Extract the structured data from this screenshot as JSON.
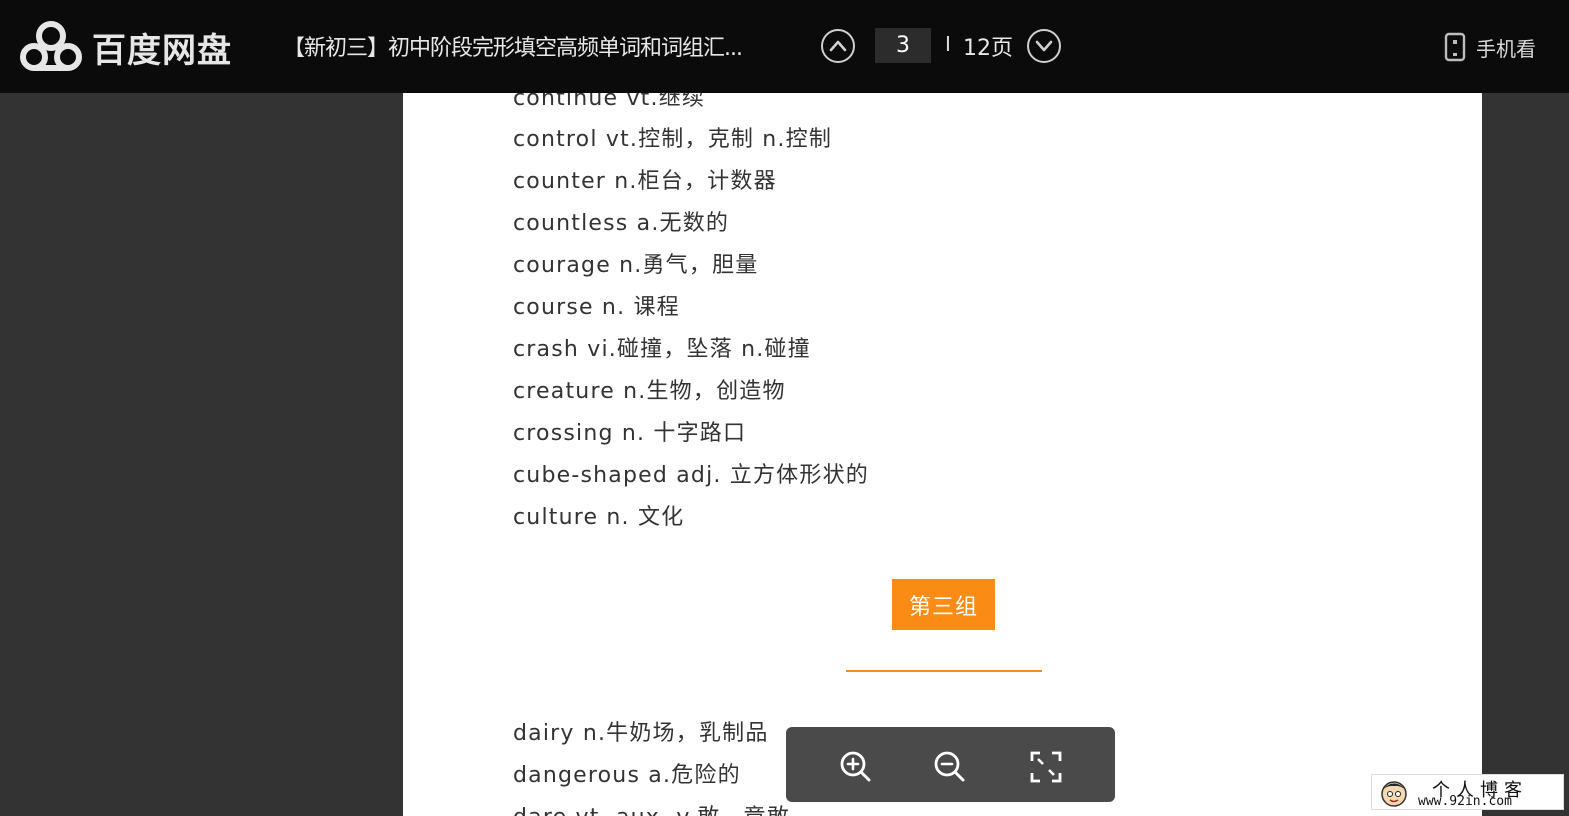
{
  "header": {
    "logo_text": "百度网盘",
    "doc_title": "【新初三】初中阶段完形填空高频单词和词组汇...",
    "current_page": "3",
    "separator": "I",
    "total_pages": "12页",
    "mobile_label": "手机看"
  },
  "document": {
    "lines_before": [
      "continue vt.继续",
      "control vt.控制，克制 n.控制",
      "counter n.柜台，计数器",
      "countless a.无数的",
      "courage n.勇气，胆量",
      "course n. 课程",
      "crash vi.碰撞，坠落 n.碰撞",
      "creature n.生物，创造物",
      "crossing n. 十字路口",
      "cube-shaped adj. 立方体形状的",
      "culture n. 文化"
    ],
    "section_title": "第三组",
    "lines_after": [
      "dairy n.牛奶场，乳制品",
      "dangerous a.危险的",
      "dare vt. aux. v.敢，竟敢"
    ]
  },
  "zoom_toolbar": {
    "icons": [
      "zoom-in-icon",
      "zoom-out-icon",
      "fullscreen-icon"
    ]
  },
  "watermark": {
    "title": "个人博客",
    "url": "www.92in.com"
  },
  "colors": {
    "accent": "#fa8c16",
    "topbar": "#0b0b0b",
    "background": "#333333"
  }
}
